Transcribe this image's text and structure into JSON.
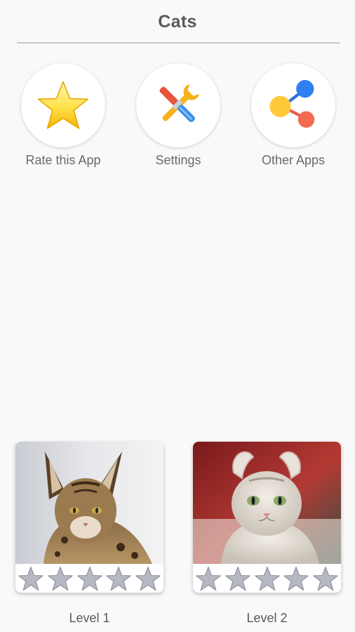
{
  "app": {
    "title": "Cats"
  },
  "quick_actions": [
    {
      "label": "Rate this App",
      "icon": "star-icon"
    },
    {
      "label": "Settings",
      "icon": "tools-icon"
    },
    {
      "label": "Other Apps",
      "icon": "share-icon"
    }
  ],
  "levels": [
    {
      "label": "Level 1",
      "stars_earned": 0,
      "stars_total": 5,
      "image": "serval-cat-photo"
    },
    {
      "label": "Level 2",
      "stars_earned": 0,
      "stars_total": 5,
      "image": "american-curl-cat-photo"
    }
  ],
  "colors": {
    "background": "#f9f9f9",
    "star_empty": "#b6b8c2",
    "accent_star": "#f7c928"
  }
}
